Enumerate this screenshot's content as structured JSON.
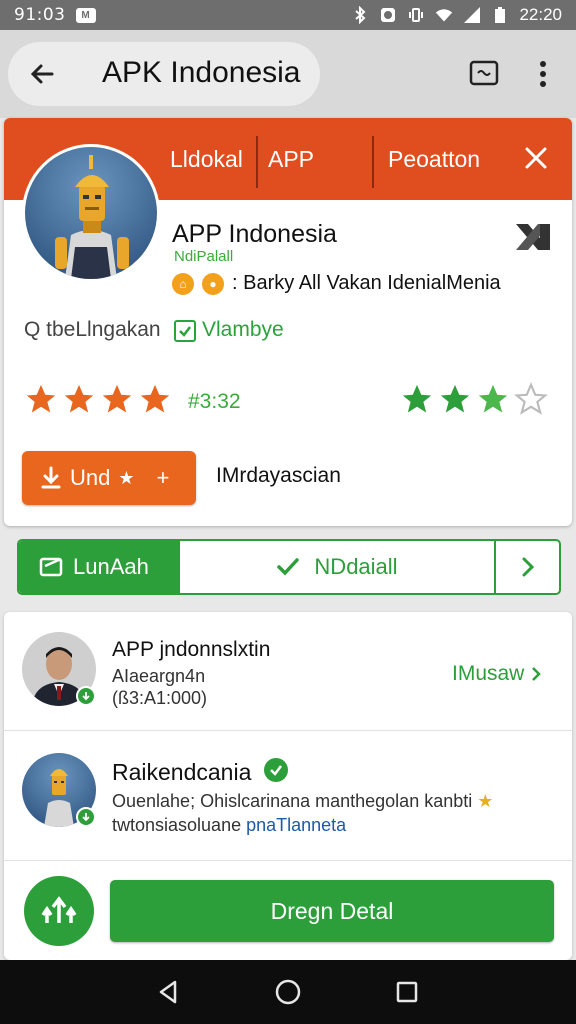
{
  "status_bar": {
    "time_left": "91:03",
    "time_right": "22:20",
    "notif_glyph": "M"
  },
  "app_bar": {
    "title": "APK Indonesia",
    "icons": [
      "back-arrow-icon",
      "cast-icon",
      "more-vert-icon"
    ]
  },
  "header": {
    "tab_1": "Lldokal",
    "tab_2": "APP",
    "tab_3": "Peoatton",
    "accent": "#e04e1f"
  },
  "app": {
    "name": "APP Indonesia",
    "developer": "NdiPalall",
    "badge_text": ": Barky All Vakan IdenialMenia",
    "search_label": "Q tbeLlngakan",
    "check_label": "Vlambye",
    "rating_text": "#3:32",
    "orange_rating": 4,
    "green_rating": 3,
    "install_label": "Und",
    "install_star": "★",
    "install_plus": "+",
    "secondary_text": "IMrdayascian"
  },
  "segmented": {
    "left_label": "LunAah",
    "mid_label": "NDdaiall",
    "green": "#2d9f3a"
  },
  "list": {
    "row1": {
      "title": "APP jndonnslxtin",
      "sub1": "AIaeargn4n",
      "sub2": "(ß3:A1:000)",
      "action": "IMusaw"
    },
    "row2": {
      "title": "Raikendcania",
      "desc_line1": "Ouenlahe; Ohislcarinana manthegolan kanbti",
      "desc_line2": "twtonsiasoluane",
      "desc_link": "pnaTlanneta"
    }
  },
  "footer": {
    "button_label": "Dregn Detal"
  },
  "nav": {
    "icons": [
      "nav-back-icon",
      "nav-home-icon",
      "nav-recents-icon"
    ]
  }
}
